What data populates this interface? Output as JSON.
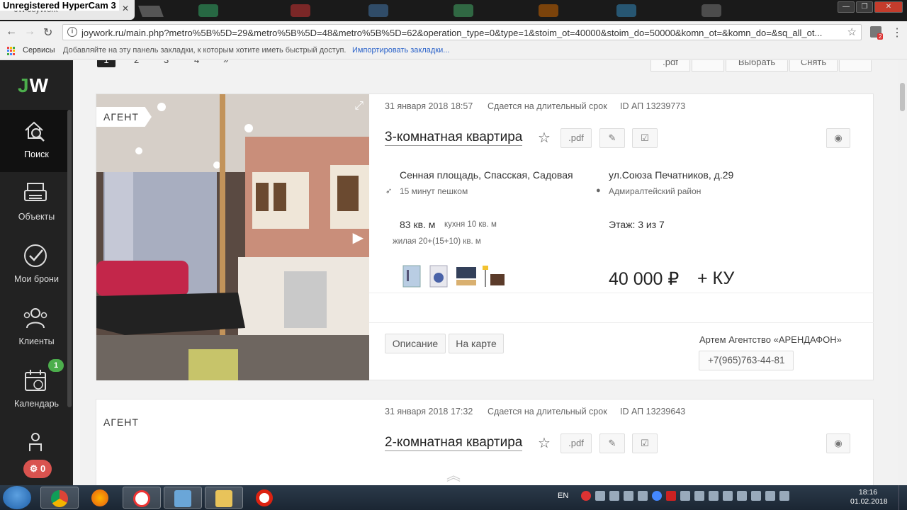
{
  "titlebar": {
    "watermark": "Unregistered HyperCam 3",
    "tab_title": "JW JoyWork",
    "tab_close": "✕",
    "win_minimize": "—",
    "win_restore": "❐",
    "win_close": "✕"
  },
  "nav": {
    "back": "←",
    "forward": "→",
    "reload": "↻",
    "info": "i",
    "url": "joywork.ru/main.php?metro%5B%5D=29&metro%5B%5D=48&metro%5B%5D=62&operation_type=0&type=1&stoim_ot=40000&stoim_do=50000&komn_ot=&komn_do=&sq_all_ot...",
    "star": "☆",
    "menu": "⋮",
    "ext_badge": "2"
  },
  "bookmarks": {
    "services": "Сервисы",
    "hint": "Добавляйте на эту панель закладки, к которым хотите иметь быстрый доступ.",
    "import_link": "Импортировать закладки..."
  },
  "sidebar": {
    "logo_j": "J",
    "logo_w": "W",
    "items": [
      {
        "label": "Поиск",
        "icon": "search-house-icon"
      },
      {
        "label": "Объекты",
        "icon": "printer-icon"
      },
      {
        "label": "Мои брони",
        "icon": "check-circle-icon"
      },
      {
        "label": "Клиенты",
        "icon": "clients-icon"
      },
      {
        "label": "Календарь",
        "icon": "calendar-icon",
        "badge": "1"
      }
    ]
  },
  "pager": {
    "pages": [
      "1",
      "2",
      "3",
      "4",
      "»"
    ],
    "buttons": [
      ".pdf",
      "Выбрать",
      "Снять"
    ]
  },
  "listings": [
    {
      "agent_tag": "АГЕНТ",
      "date": "31 января 2018",
      "time": "18:57",
      "term": "Сдается на длительный срок",
      "id": "ID АП 13239773",
      "title": "3-комнатная квартира",
      "pdf_label": ".pdf",
      "metro": "Сенная площадь, Спасская, Садовая",
      "walk": "15 минут пешком",
      "address": "ул.Союза Печатников, д.29",
      "district": "Адмиралтейский район",
      "area": "83 кв. м",
      "kitchen": "кухня 10 кв. м",
      "living": "жилая 20+(15+10) кв. м",
      "floor": "Этаж: 3 из 7",
      "price": "40 000 ₽",
      "price_extra": "+ КУ",
      "desc_btn": "Описание",
      "map_btn": "На карте",
      "agent_name": "Артем Агентство «АРЕНДАФОН»",
      "phone": "+7(965)763-44-81"
    },
    {
      "agent_tag": "АГЕНТ",
      "date": "31 января 2018",
      "time": "17:32",
      "term": "Сдается на длительный срок",
      "id": "ID АП 13239643",
      "title": "2-комнатная квартира",
      "pdf_label": ".pdf"
    }
  ],
  "counter_badge": "0",
  "taskbar": {
    "lang": "EN",
    "time": "18:16",
    "date": "01.02.2018"
  },
  "colors": {
    "accent_green": "#4cae4c",
    "badge_red": "#d9534f",
    "sidebar_bg": "#222222"
  }
}
